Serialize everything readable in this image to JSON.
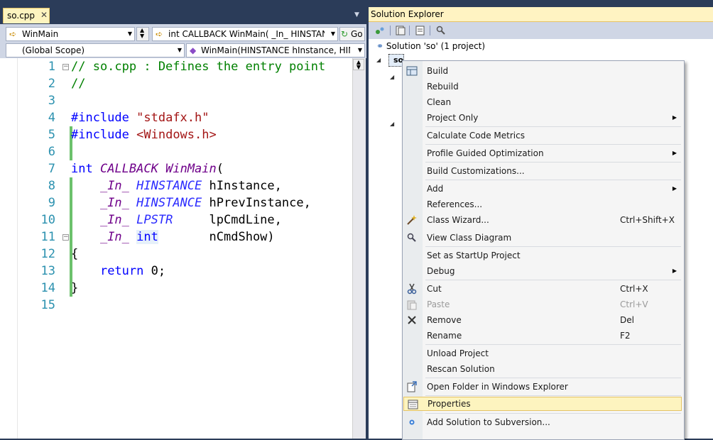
{
  "editor": {
    "tab_title": "so.cpp",
    "tab_close": "✕",
    "member_combo": "WinMain",
    "signature_combo": "int CALLBACK WinMain( _In_ HINSTANCE",
    "go_label": "Go",
    "scope_combo": "(Global Scope)",
    "function_combo": "WinMain(HINSTANCE hInstance, HINST’",
    "line_numbers": [
      "1",
      "2",
      "3",
      "4",
      "5",
      "6",
      "7",
      "8",
      "9",
      "10",
      "11",
      "12",
      "13",
      "14",
      "15"
    ],
    "code": {
      "l1": "// so.cpp : Defines the entry point",
      "l2": "//",
      "l4_kw": "#include",
      "l4_str": "\"stdafx.h\"",
      "l5_kw": "#include",
      "l5_str": "<Windows.h>",
      "l7_kw": "int",
      "l7_mac": "CALLBACK",
      "l7_fn": "WinMain",
      "l7_paren": "(",
      "l8_in": "_In_",
      "l8_type": "HINSTANCE",
      "l8_name": "hInstance,",
      "l9_in": "_In_",
      "l9_type": "HINSTANCE",
      "l9_name": "hPrevInstance,",
      "l10_in": "_In_",
      "l10_type": "LPSTR",
      "l10_name": "lpCmdLine,",
      "l11_in": "_In_",
      "l11_type": "int",
      "l11_name": "nCmdShow)",
      "l12": "{",
      "l13_kw": "return",
      "l13_rest": "0;",
      "l14": "}"
    }
  },
  "solution_explorer": {
    "title": "Solution Explorer",
    "solution_node": "Solution 'so' (1 project)",
    "project_node": "so"
  },
  "context_menu": {
    "items": [
      {
        "label": "Build",
        "shortcut": "",
        "submenu": false,
        "disabled": false
      },
      {
        "label": "Rebuild",
        "shortcut": "",
        "submenu": false,
        "disabled": false
      },
      {
        "label": "Clean",
        "shortcut": "",
        "submenu": false,
        "disabled": false
      },
      {
        "label": "Project Only",
        "shortcut": "",
        "submenu": true,
        "disabled": false
      },
      {
        "label": "Calculate Code Metrics",
        "shortcut": "",
        "submenu": false,
        "disabled": false
      },
      {
        "label": "Profile Guided Optimization",
        "shortcut": "",
        "submenu": true,
        "disabled": false
      },
      {
        "label": "Build Customizations...",
        "shortcut": "",
        "submenu": false,
        "disabled": false
      },
      {
        "label": "Add",
        "shortcut": "",
        "submenu": true,
        "disabled": false
      },
      {
        "label": "References...",
        "shortcut": "",
        "submenu": false,
        "disabled": false
      },
      {
        "label": "Class Wizard...",
        "shortcut": "Ctrl+Shift+X",
        "submenu": false,
        "disabled": false
      },
      {
        "label": "View Class Diagram",
        "shortcut": "",
        "submenu": false,
        "disabled": false
      },
      {
        "label": "Set as StartUp Project",
        "shortcut": "",
        "submenu": false,
        "disabled": false
      },
      {
        "label": "Debug",
        "shortcut": "",
        "submenu": true,
        "disabled": false
      },
      {
        "label": "Cut",
        "shortcut": "Ctrl+X",
        "submenu": false,
        "disabled": false
      },
      {
        "label": "Paste",
        "shortcut": "Ctrl+V",
        "submenu": false,
        "disabled": true
      },
      {
        "label": "Remove",
        "shortcut": "Del",
        "submenu": false,
        "disabled": false
      },
      {
        "label": "Rename",
        "shortcut": "F2",
        "submenu": false,
        "disabled": false
      },
      {
        "label": "Unload Project",
        "shortcut": "",
        "submenu": false,
        "disabled": false
      },
      {
        "label": "Rescan Solution",
        "shortcut": "",
        "submenu": false,
        "disabled": false
      },
      {
        "label": "Open Folder in Windows Explorer",
        "shortcut": "",
        "submenu": false,
        "disabled": false
      },
      {
        "label": "Properties",
        "shortcut": "",
        "submenu": false,
        "disabled": false,
        "highlighted": true
      },
      {
        "label": "Add Solution to Subversion...",
        "shortcut": "",
        "submenu": false,
        "disabled": false
      }
    ]
  },
  "colors": {
    "chrome": "#2b3c59",
    "highlight": "#fdf4bf",
    "comment": "#008000",
    "keyword": "#0000ff",
    "string": "#a31515",
    "line_number": "#2b91af",
    "changed_marker": "#6cc16c"
  }
}
